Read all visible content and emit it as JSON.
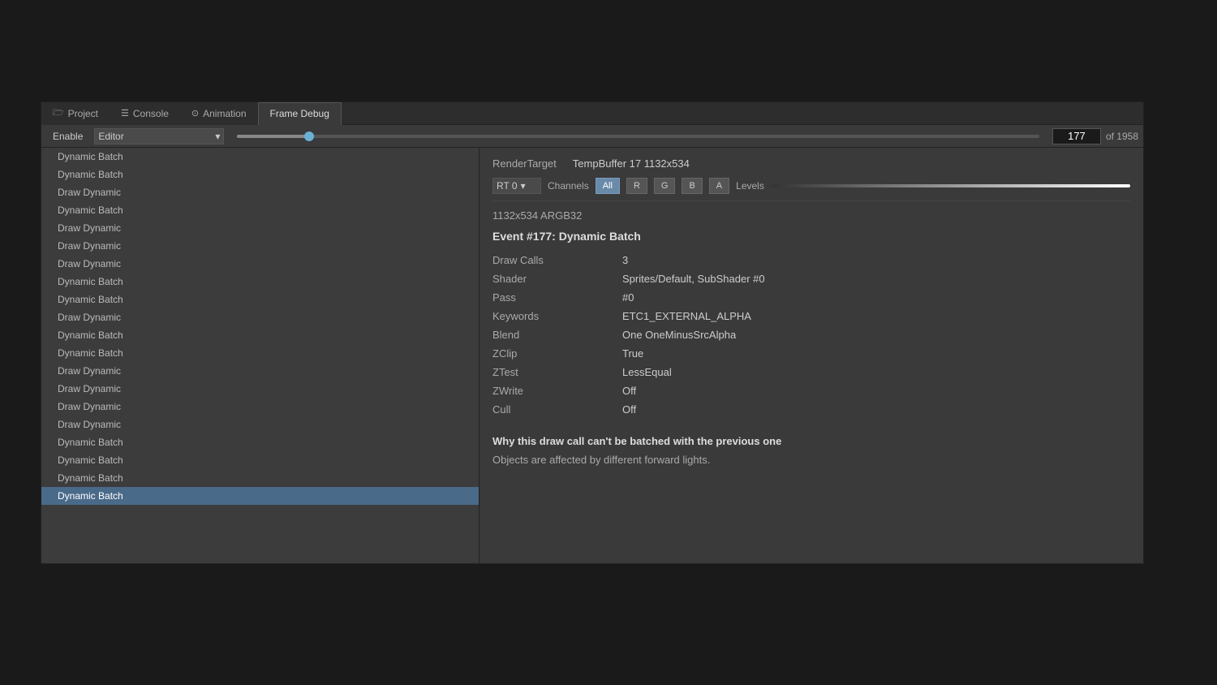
{
  "tabs": [
    {
      "id": "project",
      "label": "Project",
      "icon": "🗁",
      "active": false
    },
    {
      "id": "console",
      "label": "Console",
      "icon": "☰",
      "active": false
    },
    {
      "id": "animation",
      "label": "Animation",
      "icon": "⊙",
      "active": false
    },
    {
      "id": "frame-debug",
      "label": "Frame Debug",
      "icon": "",
      "active": true
    }
  ],
  "toolbar": {
    "enable_label": "Enable",
    "editor_option": "Editor",
    "dropdown_arrow": "▾",
    "frame_current": "177",
    "frame_of_label": "of 1958"
  },
  "list": {
    "items": [
      {
        "label": "Dynamic Batch",
        "indent": false,
        "selected": false
      },
      {
        "label": "Dynamic Batch",
        "indent": false,
        "selected": false
      },
      {
        "label": "Draw Dynamic",
        "indent": false,
        "selected": false
      },
      {
        "label": "Dynamic Batch",
        "indent": false,
        "selected": false
      },
      {
        "label": "Draw Dynamic",
        "indent": false,
        "selected": false
      },
      {
        "label": "Draw Dynamic",
        "indent": false,
        "selected": false
      },
      {
        "label": "Draw Dynamic",
        "indent": false,
        "selected": false
      },
      {
        "label": "Dynamic Batch",
        "indent": false,
        "selected": false
      },
      {
        "label": "Dynamic Batch",
        "indent": false,
        "selected": false
      },
      {
        "label": "Draw Dynamic",
        "indent": false,
        "selected": false
      },
      {
        "label": "Dynamic Batch",
        "indent": false,
        "selected": false
      },
      {
        "label": "Dynamic Batch",
        "indent": false,
        "selected": false
      },
      {
        "label": "Draw Dynamic",
        "indent": false,
        "selected": false
      },
      {
        "label": "Draw Dynamic",
        "indent": false,
        "selected": false
      },
      {
        "label": "Draw Dynamic",
        "indent": false,
        "selected": false
      },
      {
        "label": "Draw Dynamic",
        "indent": false,
        "selected": false
      },
      {
        "label": "Dynamic Batch",
        "indent": false,
        "selected": false
      },
      {
        "label": "Dynamic Batch",
        "indent": false,
        "selected": false
      },
      {
        "label": "Dynamic Batch",
        "indent": false,
        "selected": false
      },
      {
        "label": "Dynamic Batch",
        "indent": false,
        "selected": true
      }
    ]
  },
  "detail": {
    "render_target_label": "RenderTarget",
    "render_target_value": "TempBuffer 17 1132x534",
    "rt_dropdown": "RT 0",
    "channels_label": "Channels",
    "channel_buttons": [
      "All",
      "R",
      "G",
      "B",
      "A"
    ],
    "active_channel": "All",
    "levels_label": "Levels",
    "format": "1132x534 ARGB32",
    "event_title": "Event #177: Dynamic Batch",
    "properties": [
      {
        "label": "Draw Calls",
        "value": "3"
      },
      {
        "label": "Shader",
        "value": "Sprites/Default, SubShader #0"
      },
      {
        "label": "Pass",
        "value": "#0"
      },
      {
        "label": "Keywords",
        "value": "ETC1_EXTERNAL_ALPHA"
      },
      {
        "label": "Blend",
        "value": "One OneMinusSrcAlpha"
      },
      {
        "label": "ZClip",
        "value": "True"
      },
      {
        "label": "ZTest",
        "value": "LessEqual"
      },
      {
        "label": "ZWrite",
        "value": "Off"
      },
      {
        "label": "Cull",
        "value": "Off"
      }
    ],
    "batch_reason_title": "Why this draw call can't be batched with the previous one",
    "batch_reason_text": "Objects are affected by different forward lights."
  }
}
